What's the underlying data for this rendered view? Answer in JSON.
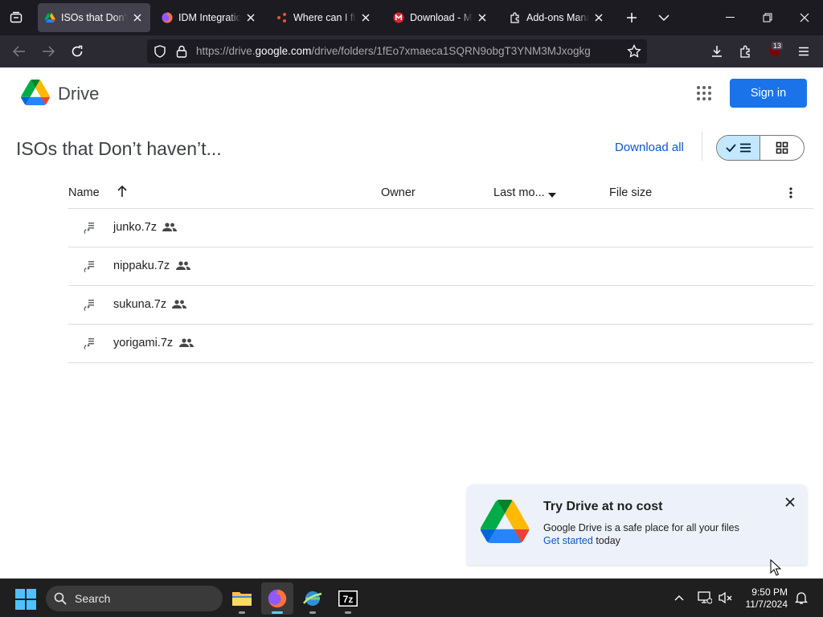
{
  "browser": {
    "tabs": [
      {
        "title": "ISOs that Don't h",
        "favicon": "google-drive-icon",
        "active": true
      },
      {
        "title": "IDM Integration",
        "favicon": "firefox-icon",
        "active": false
      },
      {
        "title": "Where can I find",
        "favicon": "ubuntu-icon",
        "active": false
      },
      {
        "title": "Download - ME",
        "favicon": "mega-icon",
        "active": false
      },
      {
        "title": "Add-ons Manag",
        "favicon": "puzzle-icon",
        "active": false
      }
    ],
    "url_prefix": "https://drive.",
    "url_domain": "google.com",
    "url_path": "/drive/folders/1fEo7xmaeca1SQRN9obgT3YNM3MJxogkg",
    "extension_badge": "13"
  },
  "drive": {
    "brand": "Drive",
    "sign_in": "Sign in",
    "folder_title": "ISOs that Don’t haven’t...",
    "download_all": "Download all",
    "columns": {
      "name": "Name",
      "owner": "Owner",
      "last_modified": "Last mo...",
      "file_size": "File size"
    },
    "files": [
      {
        "name": "junko.7z",
        "shared": true
      },
      {
        "name": "nippaku.7z",
        "shared": true
      },
      {
        "name": "sukuna.7z",
        "shared": true
      },
      {
        "name": "yorigami.7z",
        "shared": true
      }
    ],
    "promo": {
      "title": "Try Drive at no cost",
      "body": "Google Drive is a safe place for all your files",
      "link": "Get started",
      "tail": " today"
    }
  },
  "taskbar": {
    "search_placeholder": "Search",
    "time": "9:50 PM",
    "date": "11/7/2024"
  },
  "colors": {
    "accent_blue": "#1a73e8",
    "link_blue": "#0b57d0",
    "toggle_selected": "#c2e7ff",
    "browser_dark": "#1c1b22"
  }
}
